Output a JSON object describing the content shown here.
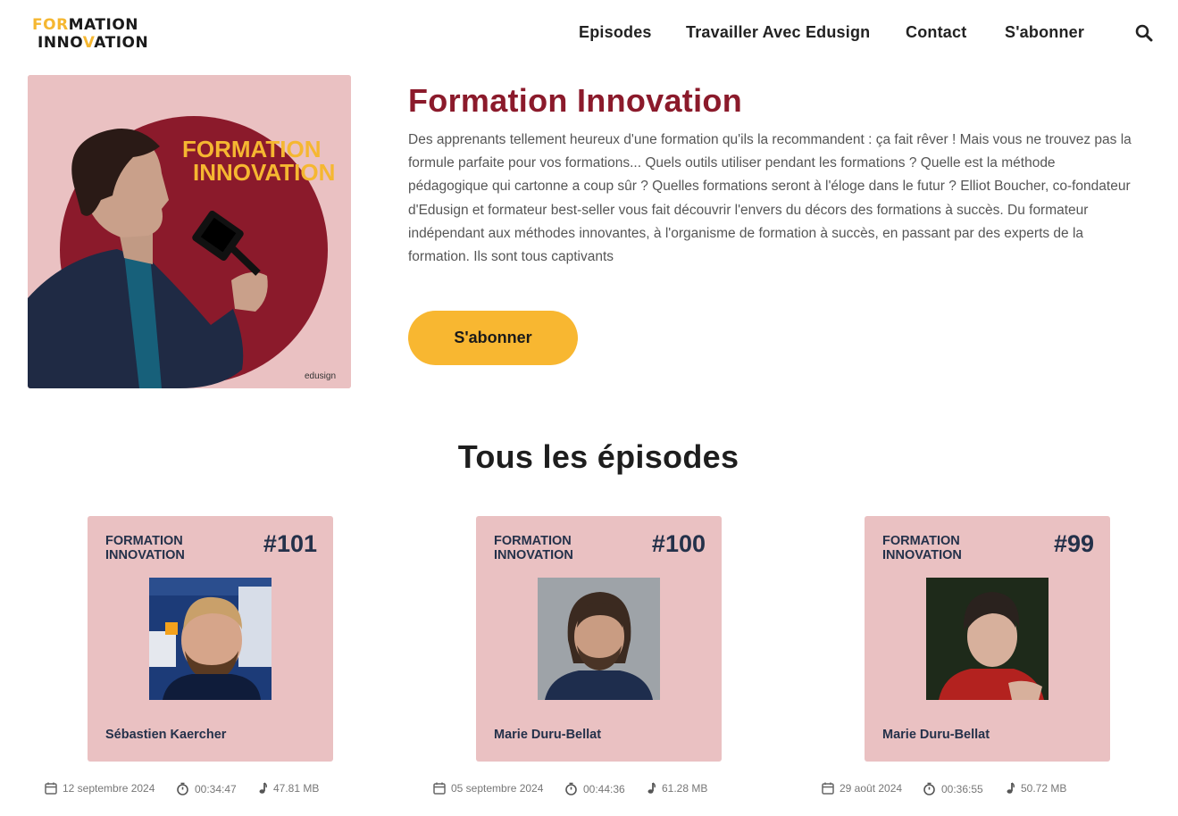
{
  "header": {
    "logo_line1": [
      "FOR",
      "M",
      "ATION"
    ],
    "logo_line2": [
      "INNO",
      "V",
      "ATION"
    ],
    "nav": [
      "Episodes",
      "Travailler Avec Edusign",
      "Contact",
      "S'abonner"
    ],
    "search_icon": "search-icon"
  },
  "podcast": {
    "cover_text_line1": "FORMATION",
    "cover_text_line2": "INNOVATION",
    "cover_brand": "edusign",
    "title": "Formation Innovation",
    "description": "Des apprenants tellement heureux d'une formation qu'ils la recommandent : ça fait rêver ! Mais vous ne trouvez pas la formule parfaite pour vos formations... Quels outils utiliser pendant les formations ? Quelle est la méthode pédagogique qui cartonne a coup sûr ? Quelles formations seront à l'éloge dans le futur ? Elliot Boucher, co-fondateur d'Edusign et formateur best-seller vous fait découvrir l'envers du décors des formations à succès. Du formateur indépendant aux méthodes innovantes, à l'organisme de formation à succès, en passant par des experts de la formation. Ils sont tous captivants",
    "subscribe_label": "S'abonner"
  },
  "episodes_section": {
    "title": "Tous les épisodes",
    "items": [
      {
        "brand_line1": "FORMATION",
        "brand_line2": "INNOVATION",
        "number": "#101",
        "guest": "Sébastien Kaercher",
        "date": "12 septembre 2024",
        "duration": "00:34:47",
        "size": "47.81 MB"
      },
      {
        "brand_line1": "FORMATION",
        "brand_line2": "INNOVATION",
        "number": "#100",
        "guest": "Marie Duru-Bellat",
        "date": "05 septembre 2024",
        "duration": "00:44:36",
        "size": "61.28 MB"
      },
      {
        "brand_line1": "FORMATION",
        "brand_line2": "INNOVATION",
        "number": "#99",
        "guest": "Marie Duru-Bellat",
        "date": "29 août 2024",
        "duration": "00:36:55",
        "size": "50.72 MB"
      }
    ]
  },
  "colors": {
    "accent": "#f8b731",
    "title": "#8b1a2b",
    "card_bg": "#eac1c2",
    "card_text": "#24314a",
    "cover_circle": "#8b1a2b"
  }
}
